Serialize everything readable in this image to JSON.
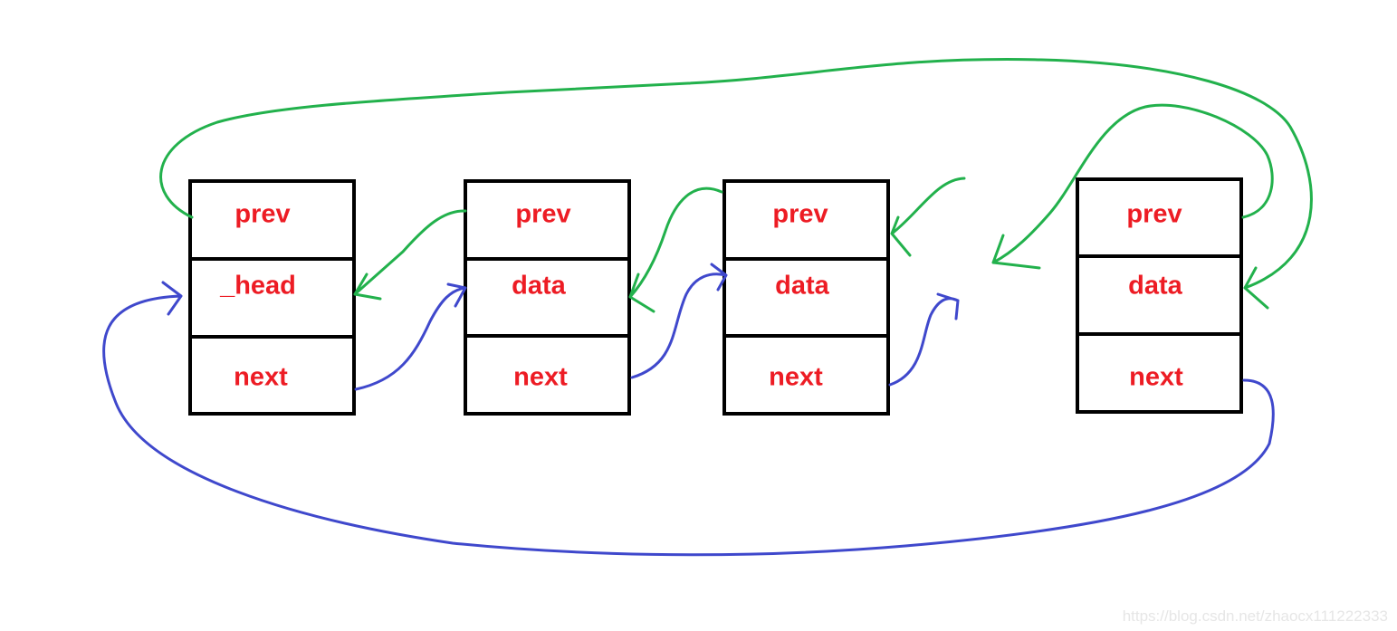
{
  "nodes": [
    {
      "fields": [
        "prev",
        "_head",
        "next"
      ]
    },
    {
      "fields": [
        "prev",
        "data",
        "next"
      ]
    },
    {
      "fields": [
        "prev",
        "data",
        "next"
      ]
    },
    {
      "fields": [
        "prev",
        "data",
        "next"
      ]
    }
  ],
  "colors": {
    "box_stroke": "#000000",
    "label": "#ed1c24",
    "prev_links": "#22b14c",
    "next_links": "#3f48cc"
  },
  "watermark": "https://blog.csdn.net/zhaocx111222333"
}
